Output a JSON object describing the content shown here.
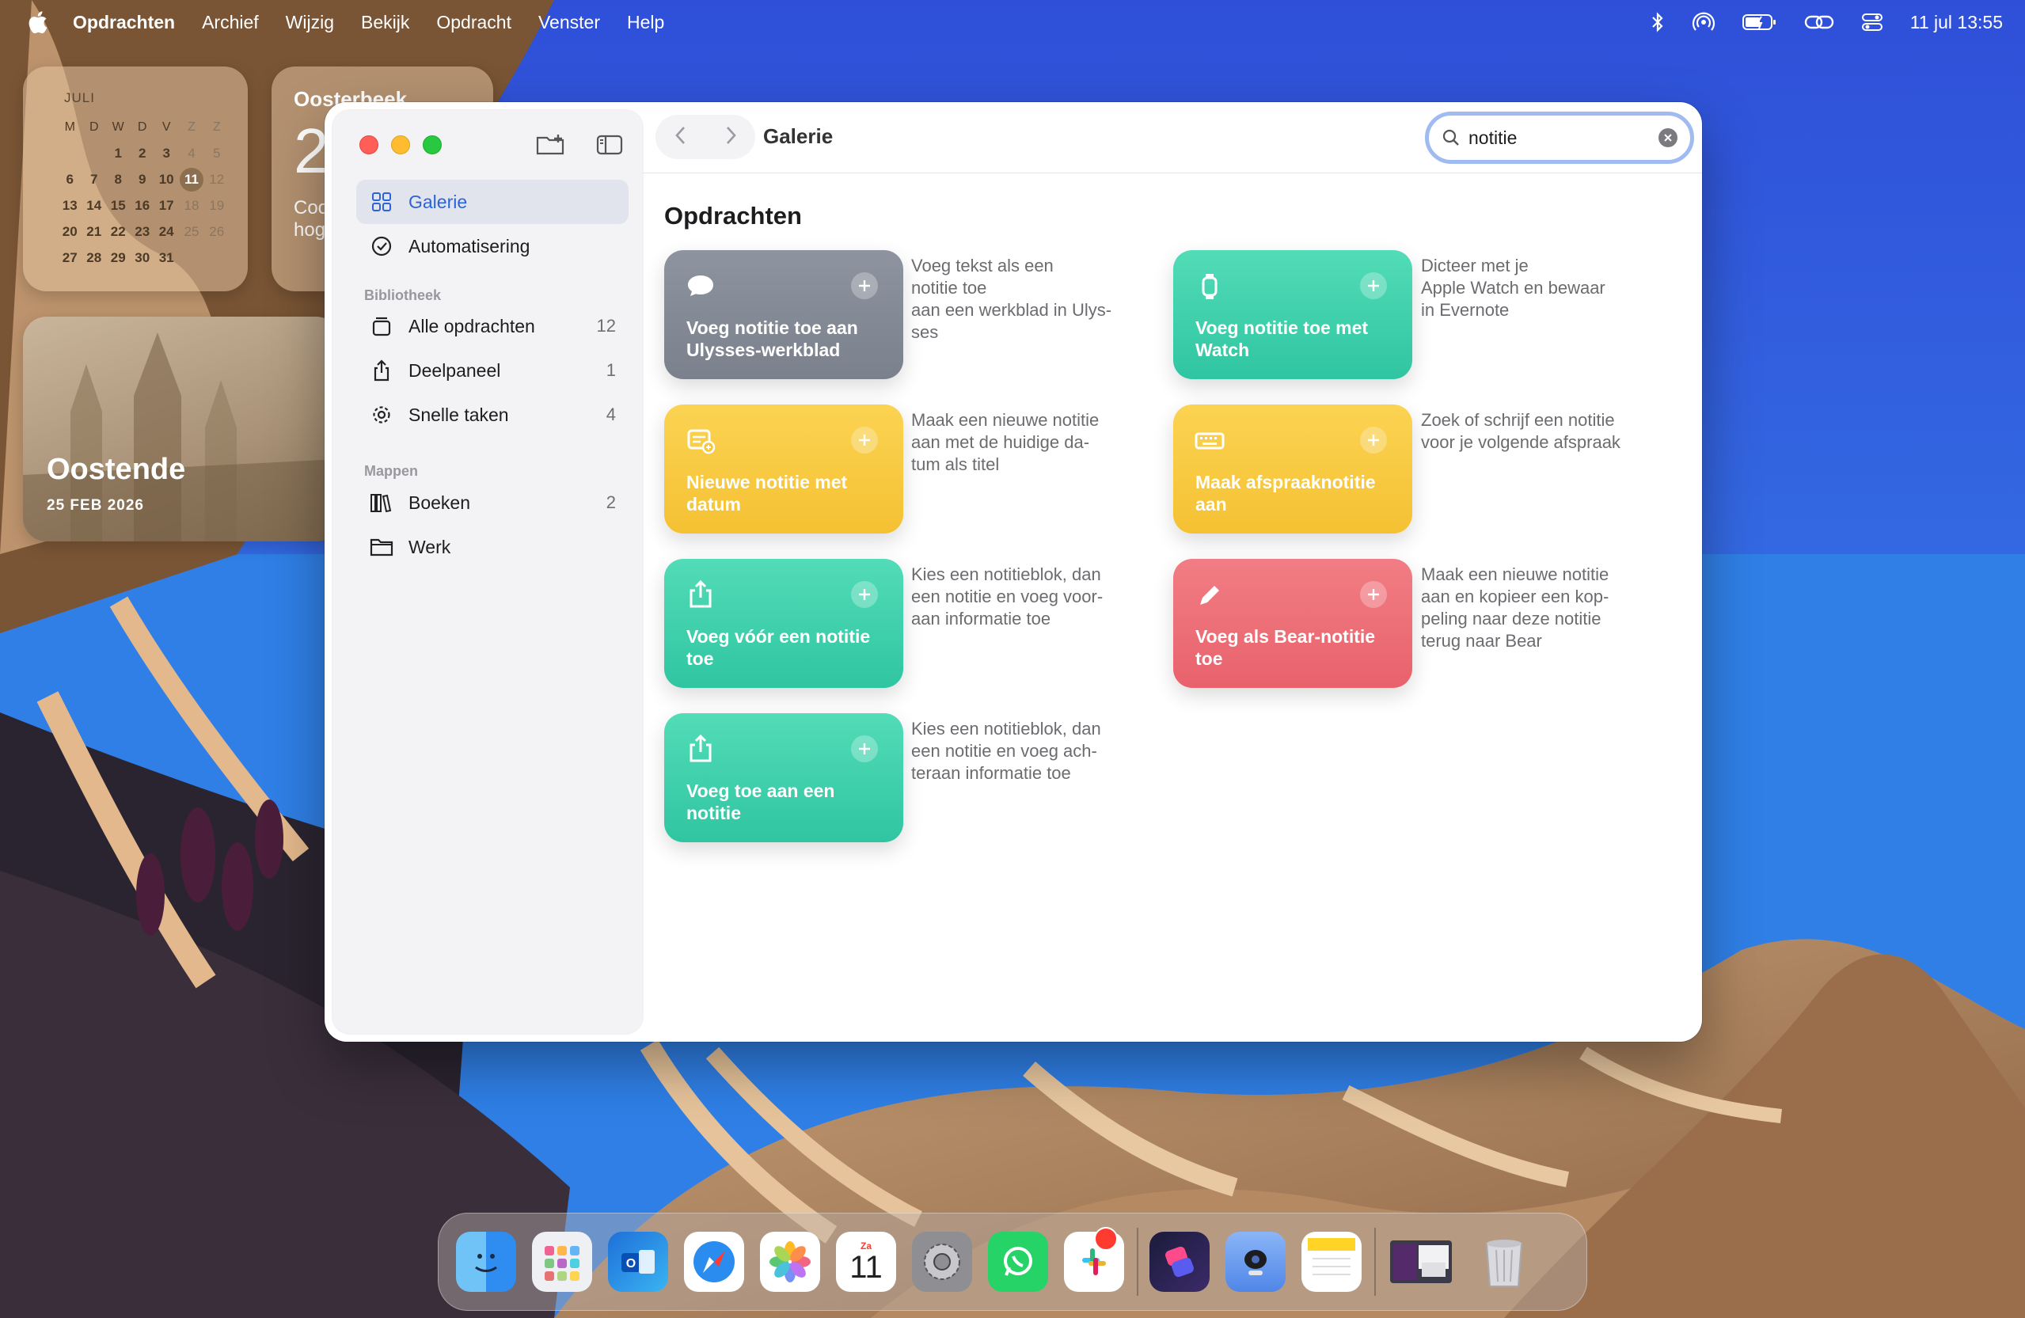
{
  "menubar": {
    "app": "Opdrachten",
    "items": [
      "Archief",
      "Wijzig",
      "Bekijk",
      "Opdracht",
      "Venster",
      "Help"
    ],
    "clock": "11 jul  13:55",
    "status_icons": [
      "bluetooth-icon",
      "airdrop-icon",
      "battery-icon",
      "link-icon",
      "control-center-icon"
    ]
  },
  "widgets": {
    "calendar": {
      "month": "JULI",
      "weekdays": [
        "M",
        "D",
        "W",
        "D",
        "V",
        "Z",
        "Z"
      ],
      "weeks": [
        [
          "",
          "",
          "",
          "",
          "",
          "",
          ""
        ],
        [
          "",
          "",
          "1",
          "2",
          "3",
          "4",
          "5"
        ],
        [
          "6",
          "7",
          "8",
          "9",
          "10",
          "11",
          "12"
        ],
        [
          "13",
          "14",
          "15",
          "16",
          "17",
          "18",
          "19"
        ],
        [
          "20",
          "21",
          "22",
          "23",
          "24",
          "25",
          "26"
        ],
        [
          "27",
          "28",
          "29",
          "30",
          "31",
          "",
          ""
        ]
      ],
      "today": "11"
    },
    "weather": {
      "location": "Oosterbeek",
      "temp": "2",
      "condition": "Coo",
      "condition2": "hog"
    },
    "photo": {
      "title": "Oostende",
      "date": "25 FEB 2026"
    }
  },
  "sidebar": {
    "primary": [
      {
        "label": "Galerie",
        "icon": "grid-icon",
        "active": true
      },
      {
        "label": "Automatisering",
        "icon": "clock-check-icon"
      }
    ],
    "library_heading": "Bibliotheek",
    "library": [
      {
        "label": "Alle opdrachten",
        "count": "12",
        "icon": "stack-icon"
      },
      {
        "label": "Deelpaneel",
        "count": "1",
        "icon": "share-icon"
      },
      {
        "label": "Snelle taken",
        "count": "4",
        "icon": "gear-icon"
      }
    ],
    "folders_heading": "Mappen",
    "folders": [
      {
        "label": "Boeken",
        "count": "2",
        "icon": "books-icon"
      },
      {
        "label": "Werk",
        "count": "",
        "icon": "folder-icon"
      }
    ]
  },
  "toolbar": {
    "title": "Galerie",
    "search_value": "notitie"
  },
  "gallery": {
    "section_title": "Opdrachten",
    "cards": [
      {
        "label": "Voeg notitie toe aan Ulysses-werkblad",
        "description": "Voeg tekst als een\nnotitie toe\naan een werkblad in Ulys-\nses",
        "color": "#858b96",
        "icon": "speech-bubble-icon"
      },
      {
        "label": "Voeg notitie toe met Watch",
        "description": "Dicteer met je\nApple Watch en bewaar\nin Evernote",
        "color": "#3fd0ad",
        "icon": "watch-icon"
      },
      {
        "label": "Nieuwe notitie met datum",
        "description": "Maak een nieuwe notitie\naan met de huidige da-\ntum als titel",
        "color": "#f7c83f",
        "icon": "calendar-note-icon"
      },
      {
        "label": "Maak afspraaknotitie aan",
        "description": "Zoek of schrijf een notitie\nvoor je volgende afspraak",
        "color": "#f7c83f",
        "icon": "keyboard-icon"
      },
      {
        "label": "Voeg vóór een notitie toe",
        "description": "Kies een notitieblok, dan\neen notitie en voeg voor-\naan informatie toe",
        "color": "#3fd0ad",
        "icon": "share-icon"
      },
      {
        "label": "Voeg als Bear-notitie toe",
        "description": "Maak een nieuwe notitie\naan en kopieer een kop-\npeling naar deze notitie\nterug naar Bear",
        "color": "#ec6d76",
        "icon": "pencil-icon"
      },
      {
        "label": "Voeg toe aan een notitie",
        "description": "Kies een notitieblok, dan\neen notitie en voeg ach-\nteraan informatie toe",
        "color": "#3fd0ad",
        "icon": "share-icon"
      }
    ]
  },
  "dock": {
    "apps": [
      "Finder",
      "Launchpad",
      "Outlook",
      "Safari",
      "Foto's",
      "Agenda",
      "Systeeminstellingen",
      "WhatsApp",
      "Slack",
      "Opdrachten",
      "Camo",
      "Notities",
      "Recente items",
      "Prullenmand"
    ],
    "calendar_day": "Za",
    "calendar_date": "11"
  }
}
